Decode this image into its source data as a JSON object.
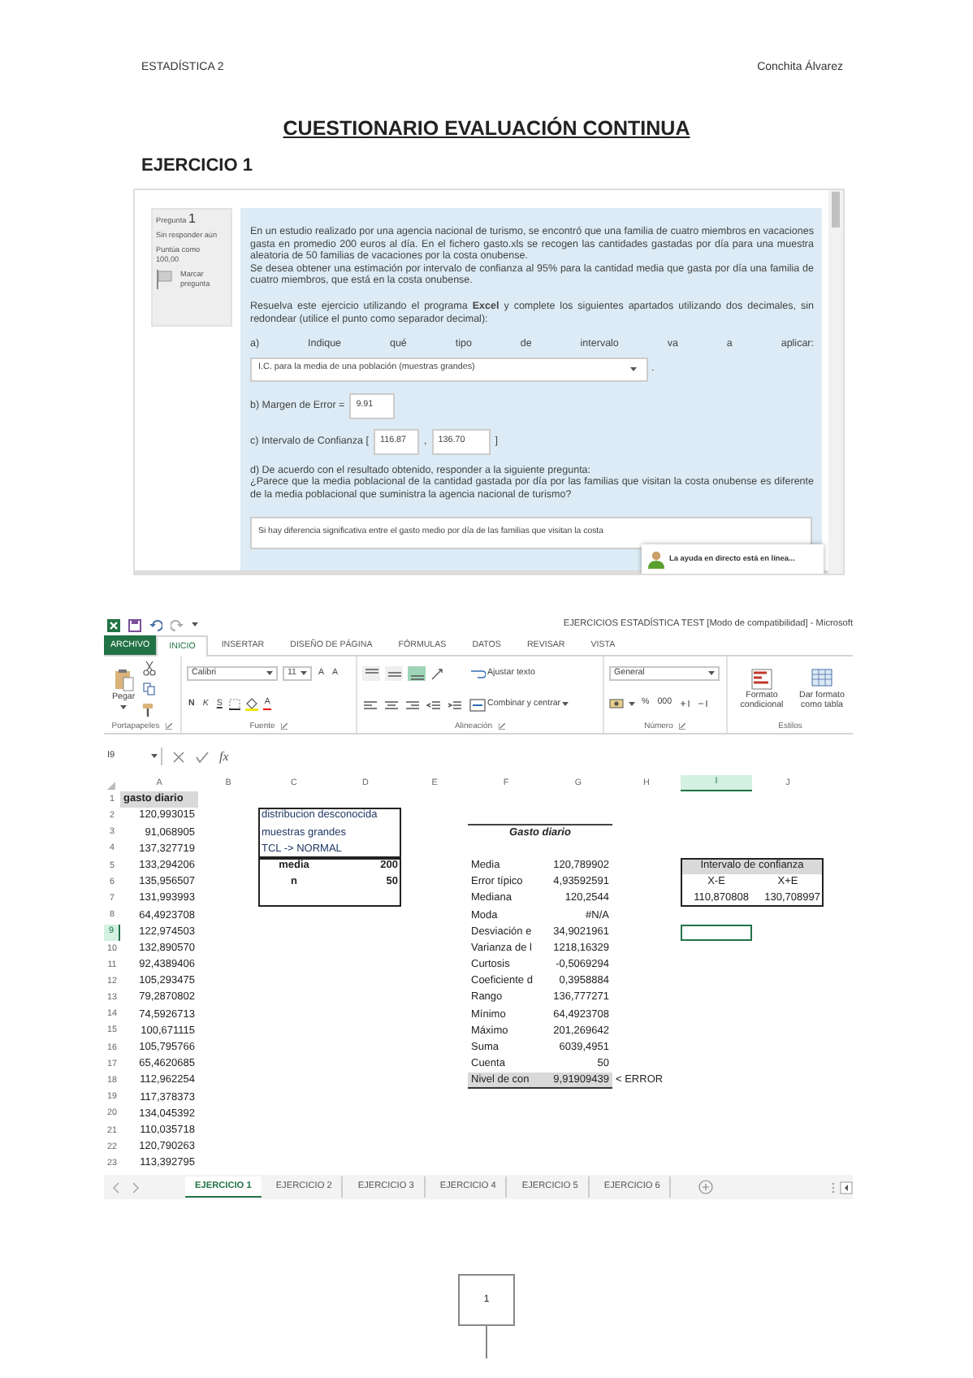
{
  "page_header": {
    "left": "ESTADÍSTICA 2",
    "right": "Conchita Álvarez"
  },
  "title": "CUESTIONARIO EVALUACIÓN CONTINUA",
  "section": "EJERCICIO 1",
  "quiz": {
    "question_label": "Pregunta",
    "question_number": "1",
    "status": "Sin responder aún",
    "points": "Puntúa como 100,00",
    "flag_label": "Marcar pregunta",
    "items": [
      {
        "kind": "paragraph",
        "lines": [
          "En un estudio realizado por una agencia nacional de turismo, se encontró que una familia de cuatro miembros en vacaciones gasta en promedio 200 euros al día. En el fichero gasto.xls se recogen las cantidades gastadas por día para una muestra aleatoria de 50 familias de vacaciones por la costa onubense.",
          "Se desea obtener una estimación por intervalo de confianza al 95% para la cantidad media que gasta por día una familia de cuatro miembros, que está en la costa onubense."
        ]
      },
      {
        "kind": "paragraph",
        "lines": [
          "Resuelva este ejercicio utilizando el programa **Excel** y complete los siguientes apartados utilizando dos decimales, sin redondear (utilice el punto como separador decimal):"
        ]
      },
      {
        "kind": "prompt",
        "text": "a) Indique qué tipo de intervalo va a aplicar:"
      },
      {
        "kind": "select",
        "value": "I.C. para la media de una población (muestras grandes)",
        "after": "."
      },
      {
        "kind": "fields",
        "parts": [
          {
            "kind": "label",
            "text": "b) Margen de Error ="
          },
          {
            "kind": "field",
            "value": "9.91"
          }
        ]
      },
      {
        "kind": "fields",
        "parts": [
          {
            "kind": "label",
            "text": "c) Intervalo de Confianza ["
          },
          {
            "kind": "field",
            "value": "116.87"
          },
          {
            "kind": "label",
            "text": ","
          },
          {
            "kind": "field",
            "value": "136.70"
          },
          {
            "kind": "label",
            "text": "]"
          }
        ]
      },
      {
        "kind": "paragraph",
        "lines": [
          "d) De acuerdo con el resultado obtenido, responder a la siguiente pregunta:",
          "¿Parece que la media poblacional de la cantidad gastada por día por las familias que visitan la costa onubense es diferente de la media poblacional que suministra la agencia nacional de turismo?"
        ]
      },
      {
        "kind": "answer",
        "value": "Si hay diferencia significativa entre el gasto medio por día de las familias que visitan la costa"
      }
    ],
    "chat": "La ayuda en directo está en línea..."
  },
  "excel": {
    "title": "EJERCICIOS ESTADÍSTICA TEST  [Modo de compatibilidad] - Microsoft",
    "file_tab": "ARCHIVO",
    "tabs": [
      {
        "label": "INICIO",
        "selected": true
      },
      {
        "label": "INSERTAR",
        "selected": false
      },
      {
        "label": "DISEÑO DE PÁGINA",
        "selected": false
      },
      {
        "label": "FÓRMULAS",
        "selected": false
      },
      {
        "label": "DATOS",
        "selected": false
      },
      {
        "label": "REVISAR",
        "selected": false
      },
      {
        "label": "VISTA",
        "selected": false
      }
    ],
    "ribbon": {
      "paste": "Pegar",
      "font_name": "Calibri",
      "font_size": "11",
      "grow_font": "A",
      "shrink_font": "A",
      "bold": "N",
      "italic": "K",
      "underline": "S",
      "font_color": "A",
      "vertical_align": [
        {
          "selected": false
        },
        {
          "selected": false
        },
        {
          "selected": true
        }
      ],
      "wrap_text": "Ajustar texto",
      "merge": "Combinar y centrar",
      "number_format": "General",
      "percent": "%",
      "thousands": "000",
      "conditional_format": "Formato condicional",
      "table_format": "Dar formato como tabla",
      "groups": [
        "Portapapeles",
        "Fuente",
        "Alineación",
        "Número",
        "Estilos"
      ]
    },
    "name_box": "I9",
    "fx": "fx",
    "columns": [
      {
        "label": "A",
        "selected": false
      },
      {
        "label": "B",
        "selected": false
      },
      {
        "label": "C",
        "selected": false
      },
      {
        "label": "D",
        "selected": false
      },
      {
        "label": "E",
        "selected": false
      },
      {
        "label": "F",
        "selected": false
      },
      {
        "label": "G",
        "selected": false
      },
      {
        "label": "H",
        "selected": false
      },
      {
        "label": "I",
        "selected": true
      },
      {
        "label": "J",
        "selected": false
      }
    ],
    "rows": [
      {
        "number": "1",
        "selected": false,
        "A": {
          "text": "gasto diario",
          "kind": "header"
        }
      },
      {
        "number": "2",
        "selected": false,
        "A": {
          "text": "120,993015",
          "kind": "number"
        },
        "C": {
          "text": "distribucion desconocida",
          "kind": "note"
        }
      },
      {
        "number": "3",
        "selected": false,
        "A": {
          "text": "91,068905",
          "kind": "number"
        },
        "C": {
          "text": "muestras grandes",
          "kind": "note"
        },
        "F": {
          "text": "Gasto diario",
          "kind": "title"
        }
      },
      {
        "number": "4",
        "selected": false,
        "A": {
          "text": "137,327719",
          "kind": "number"
        },
        "C": {
          "text": "TCL -> NORMAL",
          "kind": "note"
        }
      },
      {
        "number": "5",
        "selected": false,
        "A": {
          "text": "133,294206",
          "kind": "number"
        },
        "C": {
          "text": "media",
          "kind": "box_label"
        },
        "D": {
          "text": "200",
          "kind": "box_value"
        },
        "F": {
          "text": "Media",
          "kind": "label"
        },
        "G": {
          "text": "120,789902",
          "kind": "number"
        },
        "I": {
          "text": "Intervalo de confianza",
          "kind": "heading"
        }
      },
      {
        "number": "6",
        "selected": false,
        "A": {
          "text": "135,956507",
          "kind": "number"
        },
        "C": {
          "text": "n",
          "kind": "box_label"
        },
        "D": {
          "text": "50",
          "kind": "box_value"
        },
        "F": {
          "text": "Error típico",
          "kind": "label"
        },
        "G": {
          "text": "4,93592591",
          "kind": "number"
        },
        "I": {
          "text": "X-E",
          "kind": "center"
        },
        "J": {
          "text": "X+E",
          "kind": "center"
        }
      },
      {
        "number": "7",
        "selected": false,
        "A": {
          "text": "131,993993",
          "kind": "number"
        },
        "F": {
          "text": "Mediana",
          "kind": "label"
        },
        "G": {
          "text": "120,2544",
          "kind": "number"
        },
        "I": {
          "text": "110,870808",
          "kind": "number"
        },
        "J": {
          "text": "130,708997",
          "kind": "number"
        }
      },
      {
        "number": "8",
        "selected": false,
        "A": {
          "text": "64,4923708",
          "kind": "number"
        },
        "F": {
          "text": "Moda",
          "kind": "label"
        },
        "G": {
          "text": "#N/A",
          "kind": "number"
        }
      },
      {
        "number": "9",
        "selected": true,
        "A": {
          "text": "122,974503",
          "kind": "number"
        },
        "F": {
          "text": "Desviación e",
          "kind": "label"
        },
        "G": {
          "text": "34,9021961",
          "kind": "number"
        }
      },
      {
        "number": "10",
        "selected": false,
        "A": {
          "text": "132,890570",
          "kind": "number"
        },
        "F": {
          "text": "Varianza de l",
          "kind": "label"
        },
        "G": {
          "text": "1218,16329",
          "kind": "number"
        }
      },
      {
        "number": "11",
        "selected": false,
        "A": {
          "text": "92,4389406",
          "kind": "number"
        },
        "F": {
          "text": "Curtosis",
          "kind": "label"
        },
        "G": {
          "text": "-0,5069294",
          "kind": "number"
        }
      },
      {
        "number": "12",
        "selected": false,
        "A": {
          "text": "105,293475",
          "kind": "number"
        },
        "F": {
          "text": "Coeficiente d",
          "kind": "label"
        },
        "G": {
          "text": "0,3958884",
          "kind": "number"
        }
      },
      {
        "number": "13",
        "selected": false,
        "A": {
          "text": "79,2870802",
          "kind": "number"
        },
        "F": {
          "text": "Rango",
          "kind": "label"
        },
        "G": {
          "text": "136,777271",
          "kind": "number"
        }
      },
      {
        "number": "14",
        "selected": false,
        "A": {
          "text": "74,5926713",
          "kind": "number"
        },
        "F": {
          "text": "Mínimo",
          "kind": "label"
        },
        "G": {
          "text": "64,4923708",
          "kind": "number"
        }
      },
      {
        "number": "15",
        "selected": false,
        "A": {
          "text": "100,671115",
          "kind": "number"
        },
        "F": {
          "text": "Máximo",
          "kind": "label"
        },
        "G": {
          "text": "201,269642",
          "kind": "number"
        }
      },
      {
        "number": "16",
        "selected": false,
        "A": {
          "text": "105,795766",
          "kind": "number"
        },
        "F": {
          "text": "Suma",
          "kind": "label"
        },
        "G": {
          "text": "6039,4951",
          "kind": "number"
        }
      },
      {
        "number": "17",
        "selected": false,
        "A": {
          "text": "65,4620685",
          "kind": "number"
        },
        "F": {
          "text": "Cuenta",
          "kind": "label"
        },
        "G": {
          "text": "50",
          "kind": "number"
        }
      },
      {
        "number": "18",
        "selected": false,
        "A": {
          "text": "112,962254",
          "kind": "number"
        },
        "F": {
          "text": "Nivel de con",
          "kind": "result"
        },
        "G": {
          "text": "9,91909439",
          "kind": "result_number"
        },
        "H": {
          "text": "< ERROR",
          "kind": "label"
        }
      },
      {
        "number": "19",
        "selected": false,
        "A": {
          "text": "117,378373",
          "kind": "number"
        }
      },
      {
        "number": "20",
        "selected": false,
        "A": {
          "text": "134,045392",
          "kind": "number"
        }
      },
      {
        "number": "21",
        "selected": false,
        "A": {
          "text": "110,035718",
          "kind": "number"
        }
      },
      {
        "number": "22",
        "selected": false,
        "A": {
          "text": "120,790263",
          "kind": "number"
        }
      },
      {
        "number": "23",
        "selected": false,
        "A": {
          "text": "113,392795",
          "kind": "number"
        }
      }
    ],
    "sheets": [
      {
        "label": "EJERCICIO 1",
        "selected": true
      },
      {
        "label": "EJERCICIO 2",
        "selected": false
      },
      {
        "label": "EJERCICIO 3",
        "selected": false
      },
      {
        "label": "EJERCICIO 4",
        "selected": false
      },
      {
        "label": "EJERCICIO 5",
        "selected": false
      },
      {
        "label": "EJERCICIO 6",
        "selected": false
      }
    ]
  },
  "page_number": "1"
}
